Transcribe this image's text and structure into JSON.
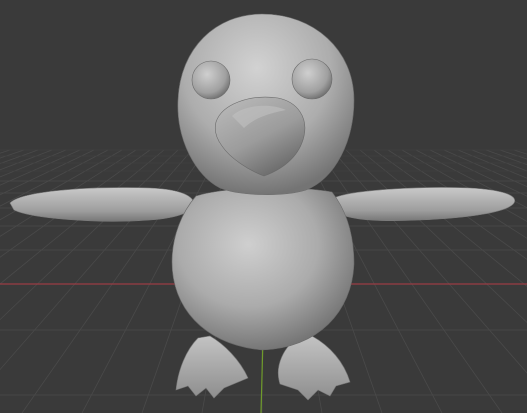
{
  "viewport": {
    "background_color": "#3a3a3a",
    "grid_color": "#4a4a4a",
    "grid_far_color": "#414141",
    "x_axis_color": "#9a3c44",
    "y_axis_color": "#6f9b2b"
  },
  "model": {
    "name_icon": "penguin-mesh",
    "base_color": "#a7a7a7",
    "shadow_color": "#6f6f6f",
    "highlight_color": "#d0d0d0",
    "shading": "solid"
  }
}
